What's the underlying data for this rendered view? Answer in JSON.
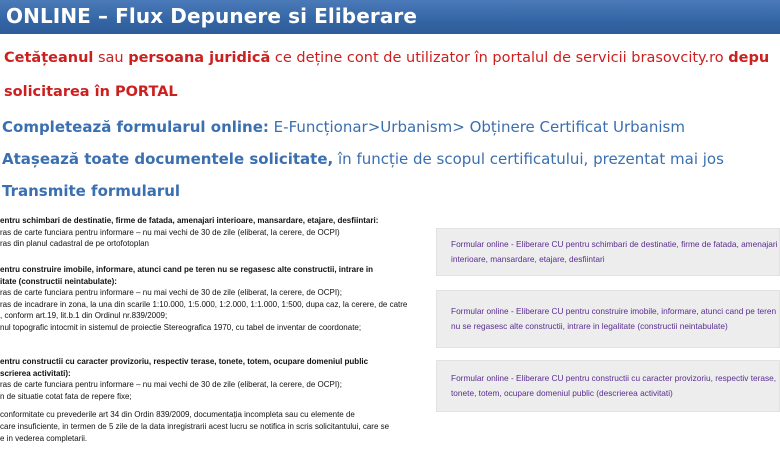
{
  "header": {
    "title": "ONLINE – Flux Depunere si Eliberare"
  },
  "intro": {
    "part1": "Cetățeanul",
    "part2": " sau ",
    "part3": "persoana juridică",
    "part4": " ce deține cont de utilizator în portalul de servicii brasovcity.ro ",
    "part5": "depu",
    "line2": "solicitarea în PORTAL"
  },
  "steps": [
    {
      "bold": "Completează formularul online:",
      "rest": " E-Funcționar>Urbanism> Obținere Certificat Urbanism"
    },
    {
      "bold": "Atașează toate documentele solicitate,",
      "rest": " în funcție de scopul certificatului, prezentat mai jos"
    },
    {
      "bold": "Transmite formularul",
      "rest": ""
    }
  ],
  "requirements": [
    {
      "header": "entru schimbari de destinatie, firme de fatada, amenajari interioare, mansardare, etajare, desfiintari:",
      "lines": [
        "ras de carte funciara pentru informare – nu mai vechi de 30 de zile (eliberat, la cerere, de OCPI)",
        "ras din planul cadastral de pe ortofotoplan"
      ]
    },
    {
      "header": "entru construire imobile, informare, atunci cand pe teren nu se regasesc alte constructii, intrare in",
      "header2": "itate (constructii neintabulate):",
      "lines": [
        "ras de carte funciara pentru informare – nu mai vechi de 30 de zile (eliberat, la cerere, de OCPI);",
        "ras de incadrare in zona, la una din scarile 1:10.000, 1:5.000, 1:2.000, 1:1.000, 1:500, dupa caz, la cerere, de catre",
        ", conform art.19, lit.b.1 din Ordinul nr.839/2009;",
        "nul topografic intocmit in sistemul de proiectie Stereografica 1970, cu tabel de inventar de coordonate;"
      ]
    },
    {
      "header": "entru constructii cu caracter provizoriu, respectiv terase, tonete, totem, ocupare domeniul public",
      "header2": "scrierea activitati):",
      "lines": [
        "ras de carte funciara pentru informare – nu mai vechi de 30 de zile (eliberat, la cerere, de OCPI);",
        "n de situatie cotat fata de repere fixe;"
      ]
    }
  ],
  "note": {
    "line1": "conformitate cu prevederile art 34 din Ordin 839/2009, documentația incompleta sau cu elemente de",
    "line2": "care insuficiente, in termen de 5 zile de la data inregistrarii acest lucru se notifica in scris solicitantului, care se",
    "line3": "e in vederea completarii."
  },
  "form_links": [
    "Formular online - Eliberare CU pentru schimbari de destinatie, firme de fatada, amenajari interioare, mansardare, etajare, desfiintari",
    "Formular online - Eliberare CU pentru construire imobile, informare, atunci cand pe teren nu se regasesc alte constructii, intrare in legalitate (constructii neintabulate)",
    "Formular online - Eliberare CU pentru constructii cu caracter provizoriu, respectiv terase, tonete, totem, ocupare domeniul public (descrierea activitati)"
  ],
  "colors": {
    "header_bg": "#3465a4",
    "intro_red": "#cc1f1f",
    "step_blue": "#3a6fb0",
    "link_purple": "#5a2d91",
    "link_bg": "#ededed"
  }
}
